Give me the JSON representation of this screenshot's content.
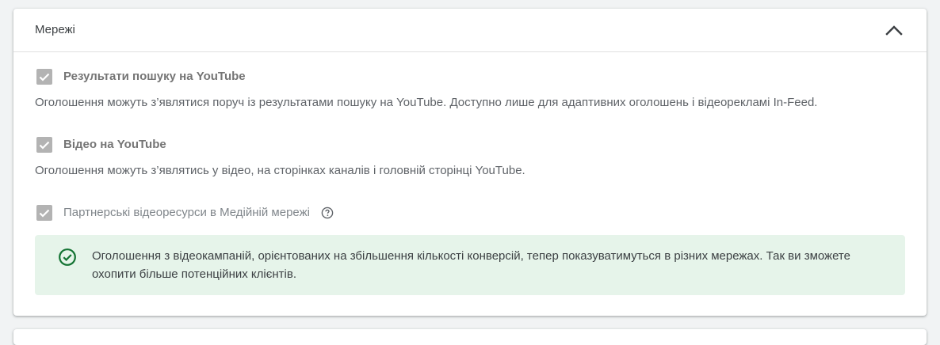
{
  "section": {
    "title": "Мережі",
    "collapse_icon": "chevron-up-icon"
  },
  "networks": [
    {
      "label": "Результати пошуку на YouTube",
      "description": "Оголошення можуть з’являтися поруч із результатами пошуку на YouTube. Доступно лише для адаптивних оголошень і відеорекламі In-Feed.",
      "checked": true,
      "disabled": true
    },
    {
      "label": "Відео на YouTube",
      "description": "Оголошення можуть з’являтись у відео, на сторінках каналів і головній сторінці YouTube.",
      "checked": true,
      "disabled": true
    },
    {
      "label": "Партнерські відеоресурси в Медійній мережі",
      "checked": true,
      "disabled": true,
      "help_icon": "help-circle-icon"
    }
  ],
  "notice": {
    "icon": "check-circle-icon",
    "text": "Оголошення з відеокампаній, орієнтованих на збільшення кількості конверсій, тепер показуватимуться в різних мережах. Так ви зможете охопити більше потенційних клієнтів."
  },
  "colors": {
    "checkbox_disabled": "#b3b3b3",
    "notice_background": "#e6f4ea",
    "notice_icon": "#137333"
  }
}
